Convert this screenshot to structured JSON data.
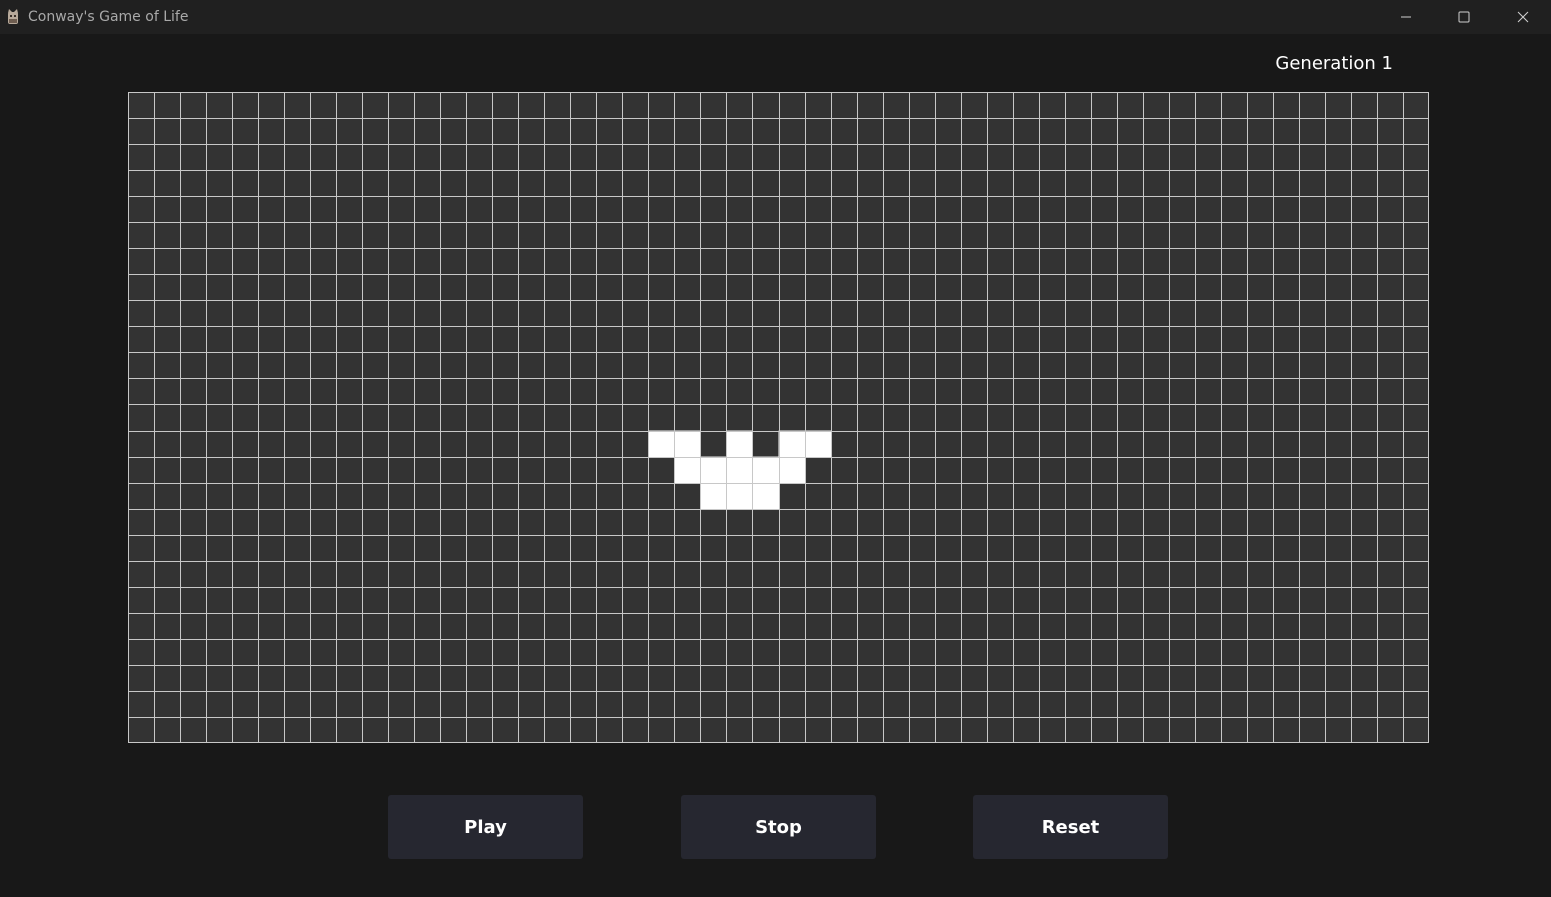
{
  "window": {
    "title": "Conway's Game of Life",
    "app_icon": "cat-icon",
    "controls": [
      "minimize-icon",
      "maximize-icon",
      "close-icon"
    ]
  },
  "status": {
    "generation_text": "Generation 1"
  },
  "board": {
    "columns": 50,
    "rows": 25,
    "cell_color_dead": "#333333",
    "cell_color_alive": "#ffffff",
    "grid_line_color": "#c8c8c8",
    "alive_cells": [
      [
        20,
        13
      ],
      [
        21,
        13
      ],
      [
        23,
        13
      ],
      [
        25,
        13
      ],
      [
        26,
        13
      ],
      [
        21,
        14
      ],
      [
        22,
        14
      ],
      [
        23,
        14
      ],
      [
        24,
        14
      ],
      [
        25,
        14
      ],
      [
        22,
        15
      ],
      [
        23,
        15
      ],
      [
        24,
        15
      ]
    ]
  },
  "buttons": {
    "play_label": "Play",
    "stop_label": "Stop",
    "reset_label": "Reset",
    "background_color": "#262730"
  }
}
